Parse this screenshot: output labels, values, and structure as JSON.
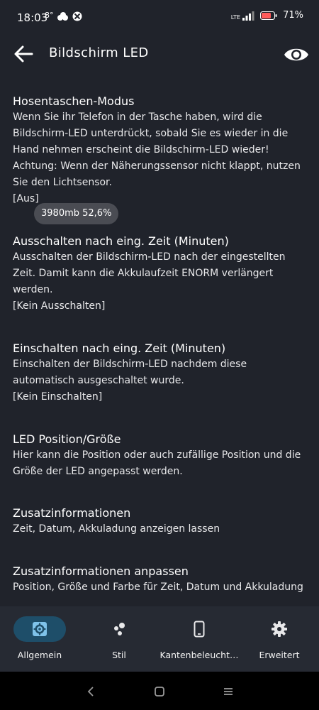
{
  "status_bar": {
    "time": "18:03",
    "temperature": "8°",
    "network": "LTE",
    "battery": "71%",
    "notification_icons": [
      "weather-cloud-icon",
      "xbox-icon"
    ]
  },
  "app_bar": {
    "title": "Bildschirm LED",
    "back_icon": "arrow-back-icon",
    "action_icon": "eye-icon"
  },
  "settings": [
    {
      "title": "Hosentaschen-Modus",
      "description": "Wenn Sie ihr Telefon in der Tasche haben, wird die Bildschirm-LED unterdrückt, sobald Sie es wieder in die Hand nehmen erscheint die Bildschirm-LED wieder! Achtung: Wenn der Näherungssensor nicht klappt, nutzen Sie den Lichtsensor.",
      "value": "[Aus]"
    },
    {
      "title": "Ausschalten nach eing. Zeit (Minuten)",
      "description": "Ausschalten der Bildschirm-LED nach der eingestellten Zeit. Damit kann die Akkulaufzeit ENORM verlängert werden.",
      "value": "[Kein Ausschalten]"
    },
    {
      "title": "Einschalten nach eing. Zeit (Minuten)",
      "description": "Einschalten der Bildschirm-LED nachdem diese automatisch ausgeschaltet wurde.",
      "value": "[Kein Einschalten]"
    },
    {
      "title": "LED Position/Größe",
      "description": "Hier kann die Position oder auch zufällige Position und die Größe der LED angepasst werden."
    },
    {
      "title": "Zusatzinformationen",
      "description": "Zeit, Datum, Akkuladung anzeigen lassen"
    },
    {
      "title": "Zusatzinformationen anpassen",
      "description": "Position, Größe und Farbe für Zeit, Datum und Akkuladung"
    }
  ],
  "toast": {
    "text": "3980mb 52,6%"
  },
  "bottom_nav": {
    "tabs": [
      {
        "label": "Allgemein",
        "icon": "settings-gear-box-icon",
        "active": true
      },
      {
        "label": "Stil",
        "icon": "bubbles-icon",
        "active": false
      },
      {
        "label": "Kantenbeleucht…",
        "icon": "phone-icon",
        "active": false
      },
      {
        "label": "Erweitert",
        "icon": "gear-icon",
        "active": false
      }
    ]
  },
  "colors": {
    "background": "#20232b",
    "bottom_nav": "#262a33",
    "active_pill": "#1e4e69",
    "accent": "#7fc3ea"
  }
}
